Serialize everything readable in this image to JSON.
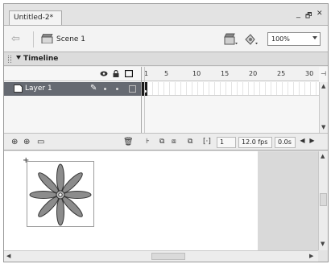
{
  "document": {
    "tab_title": "Untitled-2*"
  },
  "window_controls": {
    "minimize": "_",
    "restore": "🗗",
    "close": "✕"
  },
  "scene_bar": {
    "back_icon": "arrow-left-icon",
    "scene_label": "Scene 1",
    "zoom_value": "100%"
  },
  "timeline": {
    "title": "Timeline",
    "frame_numbers": [
      "1",
      "5",
      "10",
      "15",
      "20",
      "25",
      "30"
    ],
    "layers": [
      {
        "name": "Layer 1",
        "selected": true
      }
    ],
    "status": {
      "current_frame": "1",
      "frame_rate": "12.0 fps",
      "elapsed": "0.0s"
    }
  },
  "colors": {
    "layer_selected": "#666a72",
    "flower_fill": "#8c8c8c",
    "stage_gray": "#d9d9d9"
  }
}
